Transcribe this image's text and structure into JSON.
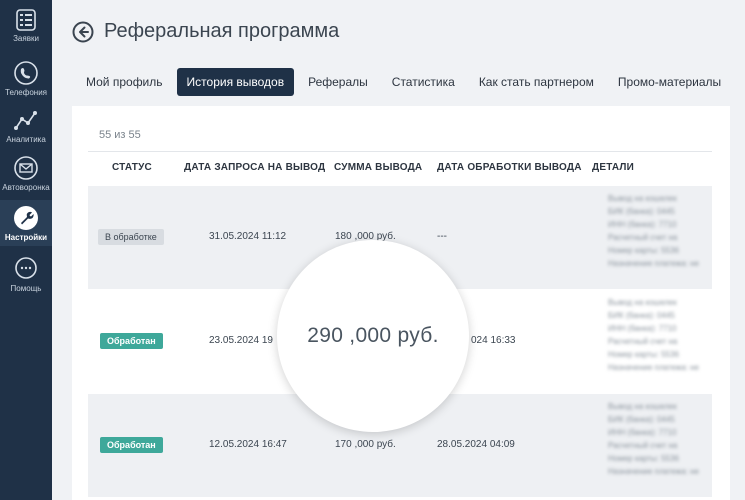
{
  "sidebar": {
    "items": [
      {
        "label": "Заявки",
        "icon": "list-icon"
      },
      {
        "label": "Телефония",
        "icon": "phone-icon"
      },
      {
        "label": "Аналитика",
        "icon": "analytics-icon"
      },
      {
        "label": "Автоворонка",
        "icon": "mail-icon"
      },
      {
        "label": "Настройки",
        "icon": "wrench-icon",
        "active": true
      },
      {
        "label": "Помощь",
        "icon": "chat-icon"
      }
    ]
  },
  "header": {
    "title": "Реферальная программа"
  },
  "tabs": [
    {
      "label": "Мой профиль"
    },
    {
      "label": "История выводов",
      "active": true
    },
    {
      "label": "Рефералы"
    },
    {
      "label": "Статистика"
    },
    {
      "label": "Как стать партнером"
    },
    {
      "label": "Промо-материалы"
    }
  ],
  "table": {
    "counter": "55 из 55",
    "headers": [
      "СТАТУС",
      "ДАТА ЗАПРОСА НА ВЫВОД",
      "СУММА ВЫВОДА",
      "ДАТА ОБРАБОТКИ ВЫВОДА",
      "ДЕТАЛИ"
    ],
    "rows": [
      {
        "status": "В обработке",
        "request_date": "31.05.2024 11:12",
        "amount": "180 ,000 руб.",
        "processed_date": "---",
        "details": [
          "Вывод на кошелек",
          "БИК (банка): 0445",
          "ИНН (банка): 7710",
          "Расчетный счет на",
          "Номер карты: 5536",
          "Назначение платежа: не"
        ]
      },
      {
        "status": "Обработан",
        "request_date": "23.05.2024 19",
        "amount": "",
        "processed_date": "024 16:33",
        "details": [
          "Вывод на кошелек",
          "БИК (банка): 0445",
          "ИНН (банка): 7710",
          "Расчетный счет на",
          "Номер карты: 5536",
          "Назначение платежа: не"
        ]
      },
      {
        "status": "Обработан",
        "request_date": "12.05.2024 16:47",
        "amount": "170 ,000 руб.",
        "processed_date": "28.05.2024 04:09",
        "details": [
          "Вывод на кошелек",
          "БИК (банка): 0445",
          "ИНН (банка): 7710",
          "Расчетный счет на",
          "Номер карты: 5536",
          "Назначение платежа: не"
        ]
      }
    ]
  },
  "magnifier": {
    "text": "290 ,000 руб."
  },
  "colors": {
    "sidebar": "#1f3147",
    "active_tab": "#1f3147",
    "done_badge": "#3ea89a",
    "processing_badge": "#d8dce1"
  }
}
